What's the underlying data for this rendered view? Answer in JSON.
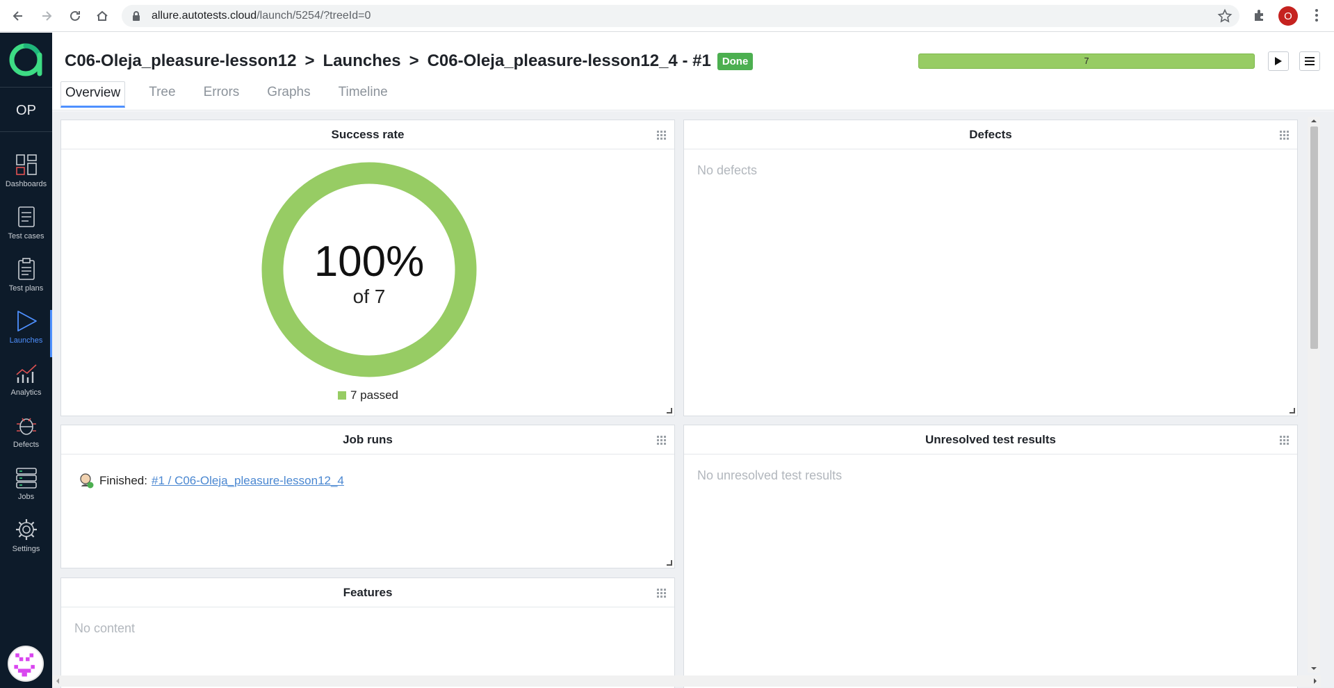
{
  "browser": {
    "url_host": "allure.autotests.cloud",
    "url_path": "/launch/5254/?treeId=0",
    "profile_initial": "O"
  },
  "sidebar": {
    "project_code": "OP",
    "items": [
      {
        "label": "Dashboards",
        "icon": "dashboards-icon"
      },
      {
        "label": "Test cases",
        "icon": "test-cases-icon"
      },
      {
        "label": "Test plans",
        "icon": "test-plans-icon"
      },
      {
        "label": "Launches",
        "icon": "launches-icon",
        "active": true
      },
      {
        "label": "Analytics",
        "icon": "analytics-icon"
      },
      {
        "label": "Defects",
        "icon": "defects-icon"
      },
      {
        "label": "Jobs",
        "icon": "jobs-icon"
      },
      {
        "label": "Settings",
        "icon": "settings-icon"
      }
    ]
  },
  "header": {
    "breadcrumb": [
      "C06-Oleja_pleasure-lesson12",
      "Launches",
      "C06-Oleja_pleasure-lesson12_4 - #1"
    ],
    "separator": ">",
    "status_badge": "Done",
    "progress_label": "7",
    "progress_fraction": 1.0,
    "tabs": [
      "Overview",
      "Tree",
      "Errors",
      "Graphs",
      "Timeline"
    ],
    "active_tab": "Overview"
  },
  "widgets": {
    "success_rate": {
      "title": "Success rate",
      "percent_text": "100%",
      "of_text": "of 7",
      "legend": "7 passed",
      "passed_fraction": 1.0,
      "color": "#97cc64"
    },
    "defects": {
      "title": "Defects",
      "empty": "No defects"
    },
    "job_runs": {
      "title": "Job runs",
      "status": "Finished:",
      "link": "#1 / C06-Oleja_pleasure-lesson12_4"
    },
    "unresolved": {
      "title": "Unresolved test results",
      "empty": "No unresolved test results"
    },
    "features": {
      "title": "Features",
      "empty": "No content"
    }
  },
  "colors": {
    "accent": "#4e90ff",
    "success": "#97cc64",
    "done_badge": "#4caf50",
    "sidebar_bg": "#0d1b2a",
    "logo": "#3ddc84"
  }
}
